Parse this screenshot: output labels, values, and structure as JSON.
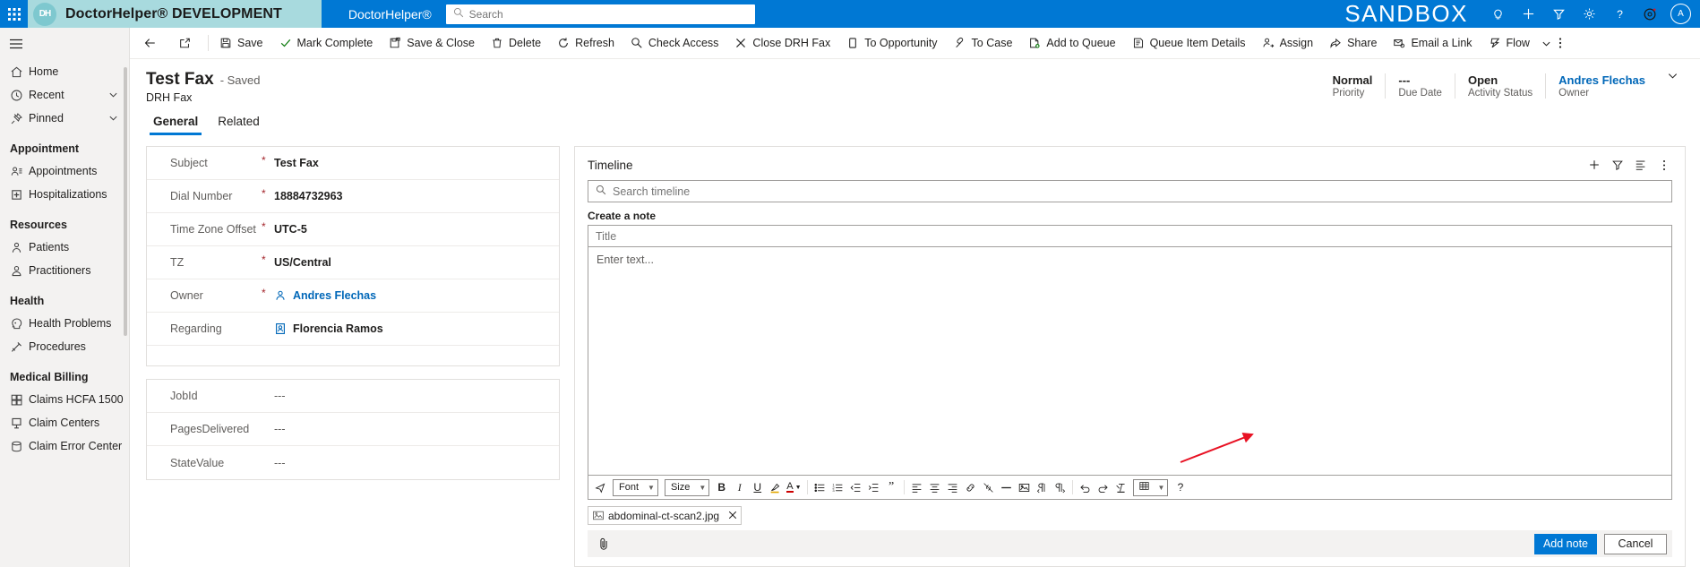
{
  "topnav": {
    "waffle_label": "app-launcher",
    "brand_logo_text": "DH",
    "brand_title": "DoctorHelper® DEVELOPMENT",
    "app_name": "DoctorHelper®",
    "search_placeholder": "Search",
    "search_value": "",
    "sandbox_label": "SANDBOX",
    "icons": [
      {
        "name": "lightbulb-icon",
        "title": "Tips"
      },
      {
        "name": "plus-icon",
        "title": "New"
      },
      {
        "name": "filter-icon",
        "title": "Filter"
      },
      {
        "name": "gear-icon",
        "title": "Settings"
      },
      {
        "name": "help-icon",
        "title": "Help"
      },
      {
        "name": "assistant-icon",
        "title": "Assistant"
      }
    ],
    "avatar_initials": "A",
    "accent_color": "#0078d4",
    "brand_color": "#a8dade"
  },
  "sidebar": {
    "hamburger": "site-map-toggle",
    "items": [
      {
        "type": "item",
        "label": "Home",
        "icon": "home-icon",
        "chevron": false
      },
      {
        "type": "item",
        "label": "Recent",
        "icon": "clock-icon",
        "chevron": true
      },
      {
        "type": "item",
        "label": "Pinned",
        "icon": "pin-icon",
        "chevron": true
      },
      {
        "type": "group",
        "label": "Appointment"
      },
      {
        "type": "item",
        "label": "Appointments",
        "icon": "appointment-icon",
        "chevron": false
      },
      {
        "type": "item",
        "label": "Hospitalizations",
        "icon": "hospital-icon",
        "chevron": false
      },
      {
        "type": "group",
        "label": "Resources"
      },
      {
        "type": "item",
        "label": "Patients",
        "icon": "patient-icon",
        "chevron": false
      },
      {
        "type": "item",
        "label": "Practitioners",
        "icon": "practitioner-icon",
        "chevron": false
      },
      {
        "type": "group",
        "label": "Health"
      },
      {
        "type": "item",
        "label": "Health Problems",
        "icon": "head-icon",
        "chevron": false
      },
      {
        "type": "item",
        "label": "Procedures",
        "icon": "procedure-icon",
        "chevron": false
      },
      {
        "type": "group",
        "label": "Medical Billing"
      },
      {
        "type": "item",
        "label": "Claims HCFA 1500",
        "icon": "claims-icon",
        "chevron": false
      },
      {
        "type": "item",
        "label": "Claim Centers",
        "icon": "claim-center-icon",
        "chevron": false
      },
      {
        "type": "item",
        "label": "Claim Error Center",
        "icon": "claim-error-icon",
        "chevron": false
      }
    ]
  },
  "commandbar": {
    "back_label": "back-icon",
    "popout_label": "open-in-new-window-icon",
    "commands": [
      {
        "label": "Save",
        "icon": "save-icon"
      },
      {
        "label": "Mark Complete",
        "icon": "check-icon"
      },
      {
        "label": "Save & Close",
        "icon": "save-close-icon"
      },
      {
        "label": "Delete",
        "icon": "trash-icon"
      },
      {
        "label": "Refresh",
        "icon": "refresh-icon"
      },
      {
        "label": "Check Access",
        "icon": "key-search-icon"
      },
      {
        "label": "Close DRH Fax",
        "icon": "close-x-icon"
      },
      {
        "label": "To Opportunity",
        "icon": "opportunity-icon"
      },
      {
        "label": "To Case",
        "icon": "case-icon"
      },
      {
        "label": "Add to Queue",
        "icon": "add-queue-icon"
      },
      {
        "label": "Queue Item Details",
        "icon": "queue-details-icon"
      },
      {
        "label": "Assign",
        "icon": "assign-user-icon"
      },
      {
        "label": "Share",
        "icon": "share-icon"
      },
      {
        "label": "Email a Link",
        "icon": "email-link-icon"
      },
      {
        "label": "Flow",
        "icon": "flow-icon"
      }
    ],
    "flow_chevron": "chevron-down-icon",
    "overflow": "more-commands-icon"
  },
  "record": {
    "title": "Test Fax",
    "saved_state": "- Saved",
    "entity": "DRH Fax",
    "header_fields": [
      {
        "value": "Normal",
        "label": "Priority",
        "link": false
      },
      {
        "value": "---",
        "label": "Due Date",
        "link": false
      },
      {
        "value": "Open",
        "label": "Activity Status",
        "link": false
      },
      {
        "value": "Andres Flechas",
        "label": "Owner",
        "link": true
      }
    ],
    "expand_icon": "chevron-down-icon"
  },
  "tabs": [
    {
      "label": "General",
      "active": true
    },
    {
      "label": "Related",
      "active": false
    }
  ],
  "form": {
    "section_one": [
      {
        "label": "Subject",
        "required": true,
        "value": "Test Fax",
        "icon": null,
        "link": false,
        "muted": false
      },
      {
        "label": "Dial Number",
        "required": true,
        "value": "18884732963",
        "icon": null,
        "link": false,
        "muted": false
      },
      {
        "label": "Time Zone Offset",
        "required": true,
        "value": "UTC-5",
        "icon": null,
        "link": false,
        "muted": false
      },
      {
        "label": "TZ",
        "required": true,
        "value": "US/Central",
        "icon": null,
        "link": false,
        "muted": false
      },
      {
        "label": "Owner",
        "required": true,
        "value": "Andres Flechas",
        "icon": "user-icon",
        "link": true,
        "muted": false
      },
      {
        "label": "Regarding",
        "required": false,
        "value": "Florencia Ramos",
        "icon": "contact-card-icon",
        "link": false,
        "muted": false
      }
    ],
    "section_two": [
      {
        "label": "JobId",
        "required": false,
        "value": "---",
        "icon": null,
        "link": false,
        "muted": true
      },
      {
        "label": "PagesDelivered",
        "required": false,
        "value": "---",
        "icon": null,
        "link": false,
        "muted": true
      },
      {
        "label": "StateValue",
        "required": false,
        "value": "---",
        "icon": null,
        "link": false,
        "muted": true
      }
    ]
  },
  "timeline": {
    "title": "Timeline",
    "actions": [
      {
        "name": "add-timeline-record-icon",
        "title": "Create a timeline record"
      },
      {
        "name": "filter-icon",
        "title": "Filter"
      },
      {
        "name": "expand-all-icon",
        "title": "Sort / Expand all"
      },
      {
        "name": "more-icon",
        "title": "More commands"
      }
    ],
    "search_placeholder": "Search timeline",
    "search_value": "",
    "create_note_label": "Create a note",
    "note_title_placeholder": "Title",
    "note_title_value": "",
    "note_body_placeholder": "Enter text...",
    "note_body_value": "",
    "rte": {
      "insert_icon": "insert-template-icon",
      "font_label": "Font",
      "size_label": "Size",
      "buttons": [
        {
          "name": "bold-icon",
          "glyph": "B"
        },
        {
          "name": "italic-icon",
          "glyph": "I"
        },
        {
          "name": "underline-icon",
          "glyph": "U"
        },
        {
          "name": "highlight-icon",
          "glyph": "highlight"
        },
        {
          "name": "font-color-icon",
          "glyph": "A"
        },
        {
          "name": "bulleted-list-icon",
          "glyph": "ul"
        },
        {
          "name": "numbered-list-icon",
          "glyph": "ol"
        },
        {
          "name": "decrease-indent-icon",
          "glyph": "outdent"
        },
        {
          "name": "increase-indent-icon",
          "glyph": "indent"
        },
        {
          "name": "blockquote-icon",
          "glyph": "quote"
        },
        {
          "name": "align-left-icon",
          "glyph": "left"
        },
        {
          "name": "align-center-icon",
          "glyph": "center"
        },
        {
          "name": "align-right-icon",
          "glyph": "right"
        },
        {
          "name": "insert-link-icon",
          "glyph": "link"
        },
        {
          "name": "remove-link-icon",
          "glyph": "unlink"
        },
        {
          "name": "horizontal-rule-icon",
          "glyph": "hr"
        },
        {
          "name": "insert-image-icon",
          "glyph": "image"
        },
        {
          "name": "rtl-icon",
          "glyph": "rtl"
        },
        {
          "name": "ltr-icon",
          "glyph": "ltr"
        },
        {
          "name": "undo-icon",
          "glyph": "undo"
        },
        {
          "name": "redo-icon",
          "glyph": "redo"
        },
        {
          "name": "clear-formatting-icon",
          "glyph": "clear"
        },
        {
          "name": "insert-table-icon",
          "glyph": "table"
        },
        {
          "name": "rte-help-icon",
          "glyph": "?"
        }
      ]
    },
    "attachment": {
      "icon": "attachment-image-icon",
      "filename": "abdominal-ct-scan2.jpg",
      "remove_icon": "close-x-icon"
    },
    "footer": {
      "attach_icon": "paperclip-icon",
      "primary_button": "Add note",
      "secondary_button": "Cancel",
      "primary_color": "#0078d4"
    },
    "annotation_arrow_color": "#e81123"
  }
}
